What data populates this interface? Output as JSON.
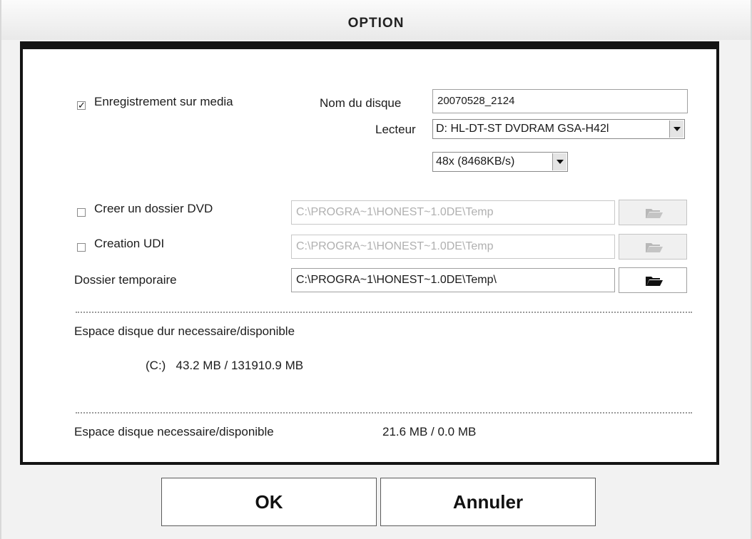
{
  "window": {
    "title": "OPTION"
  },
  "media": {
    "record_label": "Enregistrement sur media",
    "record_checked": true,
    "disc_name_label": "Nom du disque",
    "disc_name_value": "20070528_2124",
    "drive_label": "Lecteur",
    "drive_value": "D: HL-DT-ST DVDRAM GSA-H42l",
    "speed_value": "48x (8468KB/s)"
  },
  "folders": {
    "dvd_folder_label": "Creer un dossier DVD",
    "dvd_folder_checked": false,
    "dvd_folder_path": "C:\\PROGRA~1\\HONEST~1.0DE\\Temp",
    "udi_label": "Creation UDI",
    "udi_checked": false,
    "udi_path": "C:\\PROGRA~1\\HONEST~1.0DE\\Temp",
    "temp_label": "Dossier temporaire",
    "temp_path": "C:\\PROGRA~1\\HONEST~1.0DE\\Temp\\"
  },
  "space": {
    "hdd_label": "Espace disque dur necessaire/disponible",
    "hdd_value": "(C:)   43.2 MB / 131910.9 MB",
    "disc_label": "Espace disque necessaire/disponible",
    "disc_value": "21.6 MB / 0.0 MB"
  },
  "buttons": {
    "ok": "OK",
    "cancel": "Annuler"
  },
  "icons": {
    "browse": "folder-icon",
    "dropdown": "chevron-down-icon",
    "check": "checkmark-icon"
  }
}
